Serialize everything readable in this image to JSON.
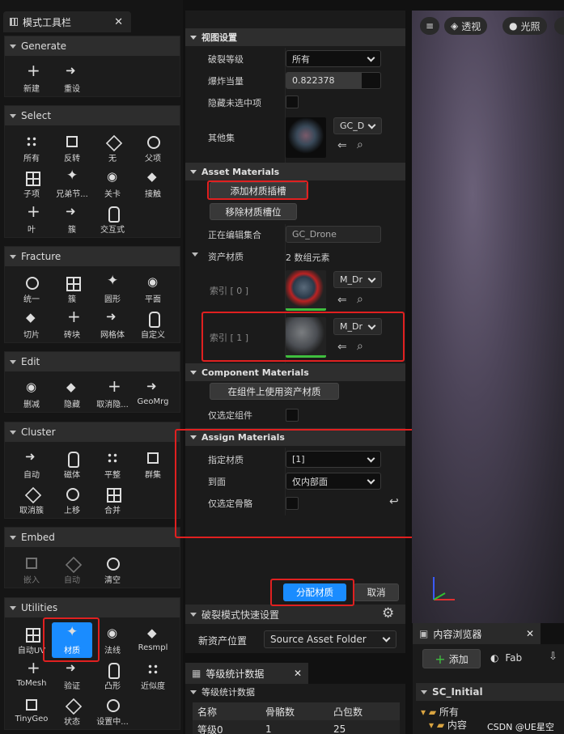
{
  "left_toolbar": {
    "tab_title": "模式工具栏",
    "sections": [
      {
        "title": "Generate",
        "tools": [
          {
            "label": "新建",
            "icon": "new-icon"
          },
          {
            "label": "重设",
            "icon": "reset-icon"
          }
        ]
      },
      {
        "title": "Select",
        "tools": [
          {
            "label": "所有",
            "icon": "select-all-icon"
          },
          {
            "label": "反转",
            "icon": "invert-icon"
          },
          {
            "label": "无",
            "icon": "select-none-icon"
          },
          {
            "label": "父项",
            "icon": "parent-icon"
          },
          {
            "label": "子项",
            "icon": "children-icon"
          },
          {
            "label": "兄弟节...",
            "icon": "siblings-icon"
          },
          {
            "label": "关卡",
            "icon": "level-icon"
          },
          {
            "label": "接触",
            "icon": "contact-icon"
          },
          {
            "label": "叶",
            "icon": "leaf-icon"
          },
          {
            "label": "簇",
            "icon": "cluster-icon"
          },
          {
            "label": "交互式",
            "icon": "interactive-icon"
          }
        ]
      },
      {
        "title": "Fracture",
        "tools": [
          {
            "label": "统一",
            "icon": "uniform-icon"
          },
          {
            "label": "簇",
            "icon": "cluster-fracture-icon"
          },
          {
            "label": "圆形",
            "icon": "radial-icon"
          },
          {
            "label": "平面",
            "icon": "plane-icon"
          },
          {
            "label": "切片",
            "icon": "slice-icon"
          },
          {
            "label": "砖块",
            "icon": "brick-icon"
          },
          {
            "label": "网格体",
            "icon": "mesh-icon"
          },
          {
            "label": "自定义",
            "icon": "custom-icon"
          }
        ]
      },
      {
        "title": "Edit",
        "tools": [
          {
            "label": "删减",
            "icon": "prune-icon"
          },
          {
            "label": "隐藏",
            "icon": "hide-icon"
          },
          {
            "label": "取消隐...",
            "icon": "unhide-icon"
          },
          {
            "label": "GeoMrg",
            "icon": "geomerge-icon"
          }
        ]
      },
      {
        "title": "Cluster",
        "tools": [
          {
            "label": "自动",
            "icon": "auto-cluster-icon"
          },
          {
            "label": "磁体",
            "icon": "magnet-icon"
          },
          {
            "label": "平整",
            "icon": "flatten-icon"
          },
          {
            "label": "群集",
            "icon": "group-icon"
          },
          {
            "label": "取消簇",
            "icon": "uncluster-icon"
          },
          {
            "label": "上移",
            "icon": "move-up-icon"
          },
          {
            "label": "合并",
            "icon": "merge-icon"
          }
        ]
      },
      {
        "title": "Embed",
        "tools": [
          {
            "label": "嵌入",
            "icon": "embed-icon",
            "dim": true
          },
          {
            "label": "自动",
            "icon": "auto-embed-icon",
            "dim": true
          },
          {
            "label": "清空",
            "icon": "clear-icon"
          }
        ]
      },
      {
        "title": "Utilities",
        "tools": [
          {
            "label": "自动UV",
            "icon": "auto-uv-icon"
          },
          {
            "label": "材质",
            "icon": "material-icon",
            "selected": true
          },
          {
            "label": "法线",
            "icon": "normals-icon"
          },
          {
            "label": "Resmpl",
            "icon": "resample-icon"
          },
          {
            "label": "ToMesh",
            "icon": "to-mesh-icon"
          },
          {
            "label": "验证",
            "icon": "validate-icon"
          },
          {
            "label": "凸形",
            "icon": "convex-icon"
          },
          {
            "label": "近似度",
            "icon": "proximity-icon"
          },
          {
            "label": "TinyGeo",
            "icon": "tiny-geo-icon"
          },
          {
            "label": "状态",
            "icon": "state-icon"
          },
          {
            "label": "设置中...",
            "icon": "set-initial-icon"
          }
        ]
      }
    ]
  },
  "details": {
    "view_settings": {
      "header": "视图设置",
      "fracture_level_label": "破裂等级",
      "fracture_level_value": "所有",
      "explode_label": "爆炸当量",
      "explode_value": "0.822378",
      "hide_unselected_label": "隐藏未选中项",
      "other_sets_label": "其他集",
      "other_sets_dropdown": "GC_D"
    },
    "asset_materials": {
      "header": "Asset Materials",
      "add_slot_button": "添加材质插槽",
      "remove_slot_button": "移除材质槽位",
      "editing_set_label": "正在编辑集合",
      "editing_set_value": "GC_Drone",
      "asset_materials_label": "资产材质",
      "asset_materials_count": "2 数组元素",
      "index0_label": "索引 [ 0 ]",
      "index0_value": "M_Dr",
      "index1_label": "索引 [ 1 ]",
      "index1_value": "M_Dr"
    },
    "component_materials": {
      "header": "Component Materials",
      "use_asset_button": "在组件上使用资产材质",
      "only_selected_components_label": "仅选定组件"
    },
    "assign_materials": {
      "header": "Assign Materials",
      "assign_label": "指定材质",
      "assign_value": "[1]",
      "to_faces_label": "到面",
      "to_faces_value": "仅内部面",
      "only_selected_bones_label": "仅选定骨骼"
    },
    "apply_button": "分配材质",
    "cancel_button": "取消",
    "quick_settings": {
      "header": "破裂模式快速设置",
      "new_asset_location_label": "新资产位置",
      "new_asset_location_value": "Source Asset Folder"
    }
  },
  "viewport": {
    "menu_icon": "hamburger-icon",
    "perspective_label": "透视",
    "lit_label": "光照"
  },
  "level_stats": {
    "tab_title": "等级统计数据",
    "section_title": "等级统计数据",
    "columns": [
      "名称",
      "骨骼数",
      "凸包数"
    ],
    "rows": [
      [
        "等级0",
        "1",
        "25"
      ]
    ]
  },
  "content_browser": {
    "tab_title": "内容浏览器",
    "add_button": "添加",
    "fab_button": "Fab",
    "tree_root": "SC_Initial",
    "tree_items": [
      "所有",
      "内容"
    ]
  },
  "watermark": "CSDN @UE星空",
  "colors": {
    "accent": "#1a8cff",
    "annotation_red": "#e02020",
    "panel_bg": "#1b1b1b",
    "header_bg": "#2e2e2e"
  }
}
